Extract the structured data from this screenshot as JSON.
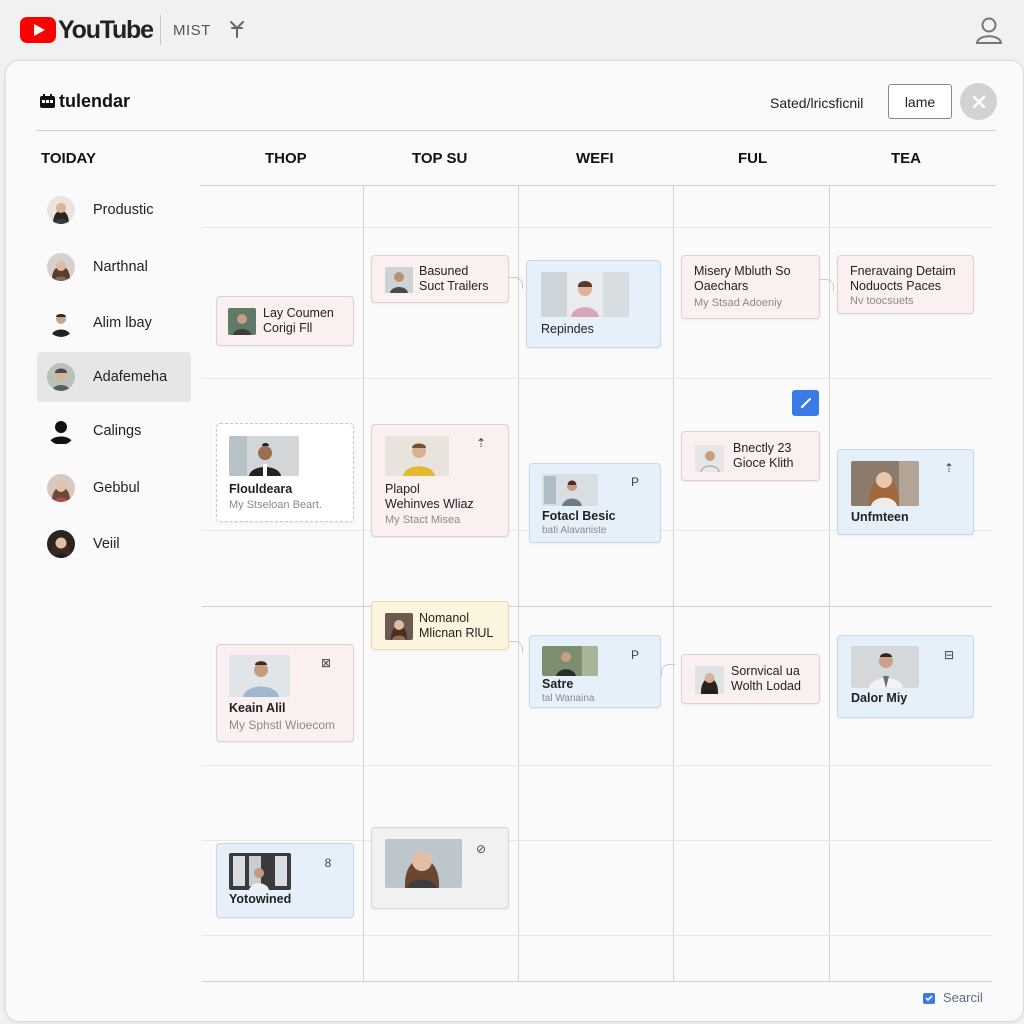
{
  "app": {
    "brand": "YouTube",
    "top_label": "MIST"
  },
  "calendar": {
    "title": "tulendar",
    "header_action": "Sated/lricsficnil",
    "header_button": "lame"
  },
  "columns": [
    "TOIDAY",
    "THOP",
    "TOP SU",
    "WEFI",
    "FUL",
    "TEA"
  ],
  "sidebar": {
    "items": [
      {
        "label": "Produstic"
      },
      {
        "label": "Narthnal"
      },
      {
        "label": "Alim lbay"
      },
      {
        "label": "Adafemeha",
        "active": true
      },
      {
        "label": "Calings"
      },
      {
        "label": "Gebbul"
      },
      {
        "label": "Veiil"
      }
    ]
  },
  "cards": {
    "thop_1": {
      "line1": "Lay Coumen",
      "line2": "Corigi Fll"
    },
    "thop_2": {
      "line1": "Flouldeara",
      "line2": "My Stseloan Beart."
    },
    "thop_3": {
      "line1": "Keain Alil",
      "line2": "My Sphstl Wioecom",
      "corner": "⊠"
    },
    "thop_4": {
      "line1": "Yotowined",
      "corner": "8"
    },
    "topsu_1": {
      "line1": "Basuned",
      "line2": "Suct Trailers"
    },
    "topsu_2": {
      "line1": "Plapol",
      "line2": "Wehinves Wliaz",
      "line3": "My Stact Misea",
      "corner": "⇡"
    },
    "topsu_3": {
      "line1": "Nomanol",
      "line2": "Mlicnan RlUL"
    },
    "topsu_4": {
      "corner": "⊘"
    },
    "wefi_1": {
      "line1": "Repindes"
    },
    "wefi_2": {
      "line1": "Fotacl Besic",
      "line2": "bati Alavaniste",
      "corner": "P"
    },
    "wefi_3": {
      "line1": "Satre",
      "line2": "tal Wanaina",
      "corner": "P"
    },
    "ful_1": {
      "line1": "Misery Mbluth So",
      "line2": "Oaechars",
      "line3": "My Stsad Adoeniy"
    },
    "ful_2": {
      "line1": "Bnectly 23",
      "line2": "Gioce Klith"
    },
    "ful_3": {
      "line1": "Sornvical ua",
      "line2": "Wolth Lodad"
    },
    "tea_1": {
      "line1": "Fneravaing Detaim",
      "line2": "Noduocts Paces",
      "line3": "Nv toocsuets"
    },
    "tea_2": {
      "line1": "Unfmteen",
      "corner": "⇡"
    },
    "tea_3": {
      "line1": "Dalor Miy",
      "corner": "⊟"
    }
  },
  "footer": {
    "search_label": "Searcil"
  },
  "icons": {
    "brand": "youtube-play-icon",
    "pin": "pin-icon",
    "account": "account-icon",
    "calendar": "calendar-icon",
    "close": "close-icon",
    "edit": "edit-icon",
    "search": "search-icon"
  },
  "colors": {
    "youtube_red": "#ff0000",
    "accent_blue": "#3b7be6",
    "card_pink": "#faf0f0",
    "card_blue": "#e6f0fb",
    "card_yellow": "#fbf5de"
  }
}
